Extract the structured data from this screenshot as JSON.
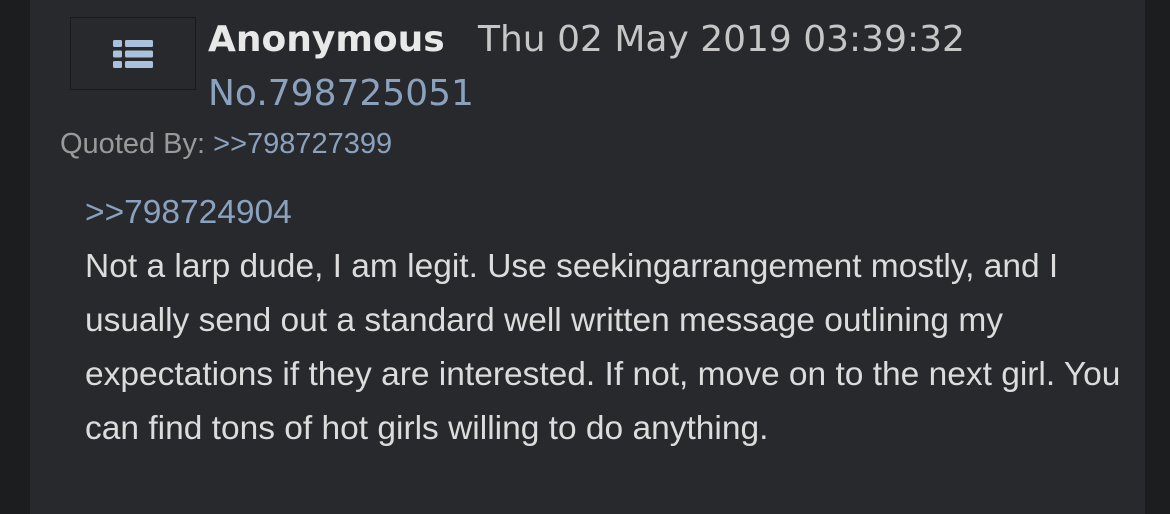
{
  "post": {
    "menu_icon": "list-menu-icon",
    "name": "Anonymous",
    "datetime": "Thu 02 May 2019 03:39:32",
    "number": "No.798725051",
    "quoted_by_label": "Quoted By:",
    "quoted_by_link": ">>798727399",
    "reply_to": ">>798724904",
    "message": "Not a larp dude, I am legit. Use seekingarrangement mostly, and I usually send out a standard well written message outlining my expectations if they are interested. If not, move on to the next girl. You can find tons of hot girls willing to do anything."
  },
  "colors": {
    "page_background": "#1c1d1f",
    "post_background": "#28292d",
    "link": "#8aa2be",
    "name": "#e8e8e8",
    "text": "#dcdcdc",
    "muted": "#9a9a9a",
    "icon": "#a9c1dd"
  }
}
